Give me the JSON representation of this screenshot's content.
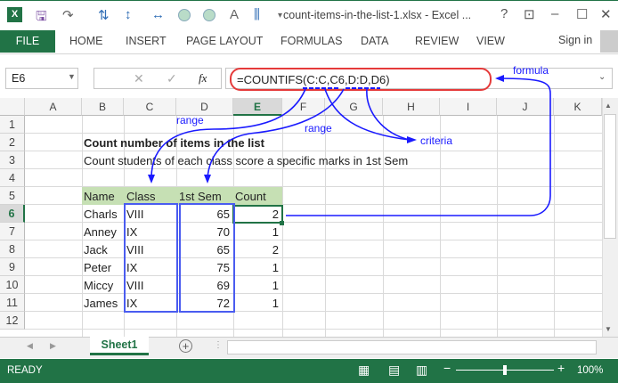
{
  "window": {
    "title": "count-items-in-the-list-1.xlsx - Excel ...",
    "help": "?",
    "minimize": "–",
    "maximize": "☐",
    "close": "✕"
  },
  "ribbon": {
    "file": "FILE",
    "tabs": [
      "HOME",
      "INSERT",
      "PAGE LAYOUT",
      "FORMULAS",
      "DATA",
      "REVIEW",
      "VIEW"
    ],
    "sign_in": "Sign in"
  },
  "formula_bar": {
    "name_box": "E6",
    "fx": "fx",
    "cancel": "✕",
    "enter": "✓",
    "formula": "=COUNTIFS(C:C,C6,D:D,D6)"
  },
  "columns": [
    "A",
    "B",
    "C",
    "D",
    "E",
    "F",
    "G",
    "H",
    "I",
    "J",
    "K"
  ],
  "rows": [
    "1",
    "2",
    "3",
    "4",
    "5",
    "6",
    "7",
    "8",
    "9",
    "10",
    "11",
    "12"
  ],
  "sheet": {
    "title": "Count number of items in the list",
    "subtitle": "Count students of each class score a specific marks in 1st Sem",
    "headers": [
      "Name",
      "Class",
      "1st Sem",
      "Count"
    ],
    "data": [
      [
        "Charls",
        "VIII",
        "65",
        "2"
      ],
      [
        "Anney",
        "IX",
        "70",
        "1"
      ],
      [
        "Jack",
        "VIII",
        "65",
        "2"
      ],
      [
        "Peter",
        "IX",
        "75",
        "1"
      ],
      [
        "Miccy",
        "VIII",
        "69",
        "1"
      ],
      [
        "James",
        "IX",
        "72",
        "1"
      ]
    ]
  },
  "annotations": {
    "formula": "formula",
    "range1": "range",
    "range2": "range",
    "criteria": "criteria"
  },
  "tabs": {
    "sheet1": "Sheet1",
    "add": "+"
  },
  "status": {
    "text": "READY",
    "zoom": "100%"
  }
}
